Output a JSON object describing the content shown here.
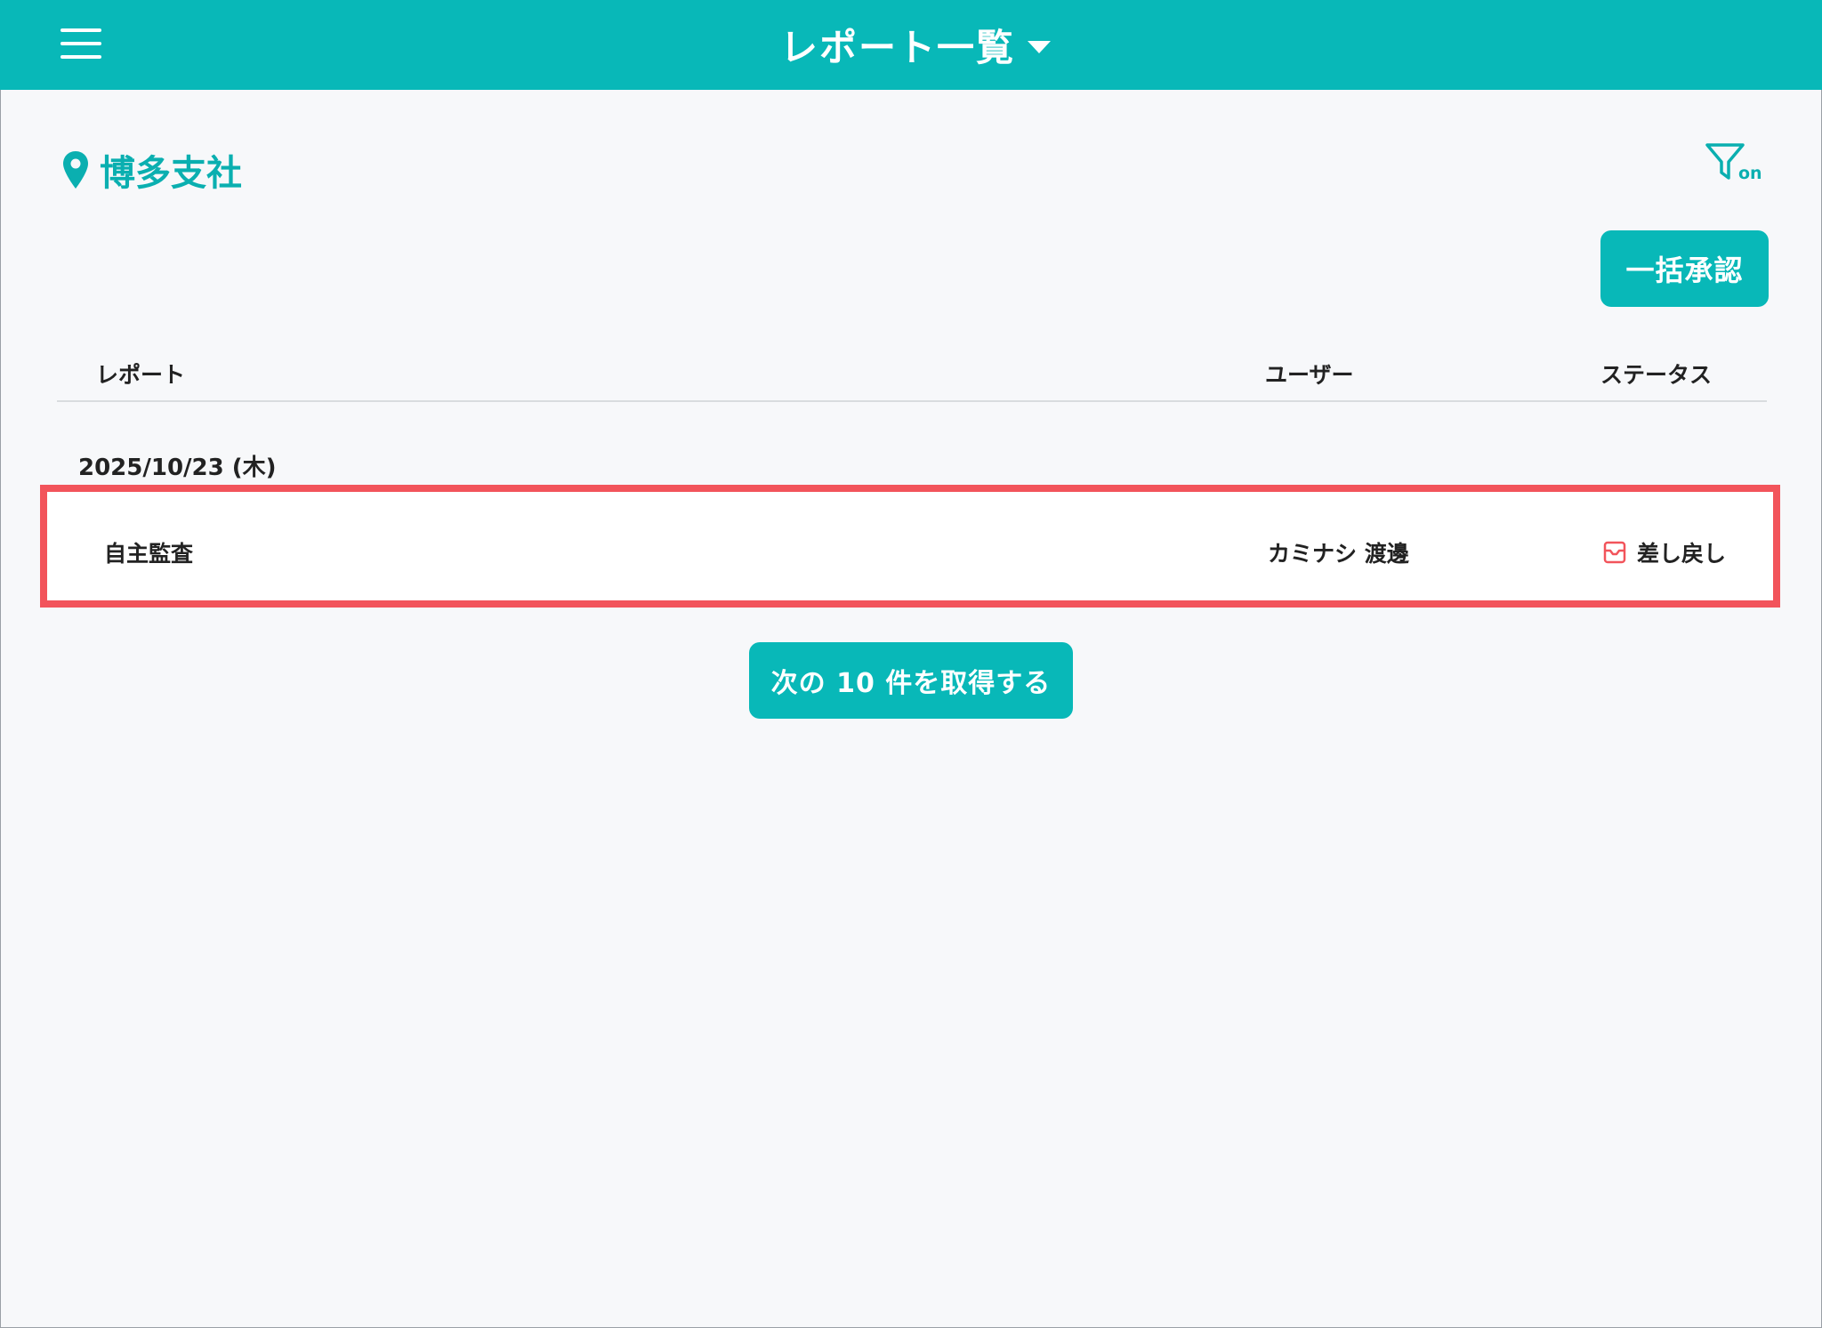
{
  "header": {
    "title": "レポート一覧",
    "menu_icon": "hamburger-menu-icon",
    "dropdown_icon": "caret-down-icon"
  },
  "location": {
    "name": "博多支社",
    "icon": "map-pin-icon"
  },
  "filter": {
    "icon": "filter-icon",
    "state_label": "on"
  },
  "toolbar": {
    "bulk_approve_label": "一括承認"
  },
  "table": {
    "columns": [
      "レポート",
      "ユーザー",
      "ステータス"
    ],
    "groups": [
      {
        "date": "2025/10/23 (木)",
        "rows": [
          {
            "report": "自主監査",
            "user": "カミナシ 渡邊",
            "status": "差し戻し",
            "status_icon": "inbox-return-icon"
          }
        ]
      }
    ]
  },
  "pagination": {
    "load_more_label": "次の 10 件を取得する"
  },
  "colors": {
    "accent": "#08b8b8",
    "highlight_border": "#f2545b",
    "status_returned": "#f2545b",
    "background": "#f7f8fa"
  }
}
